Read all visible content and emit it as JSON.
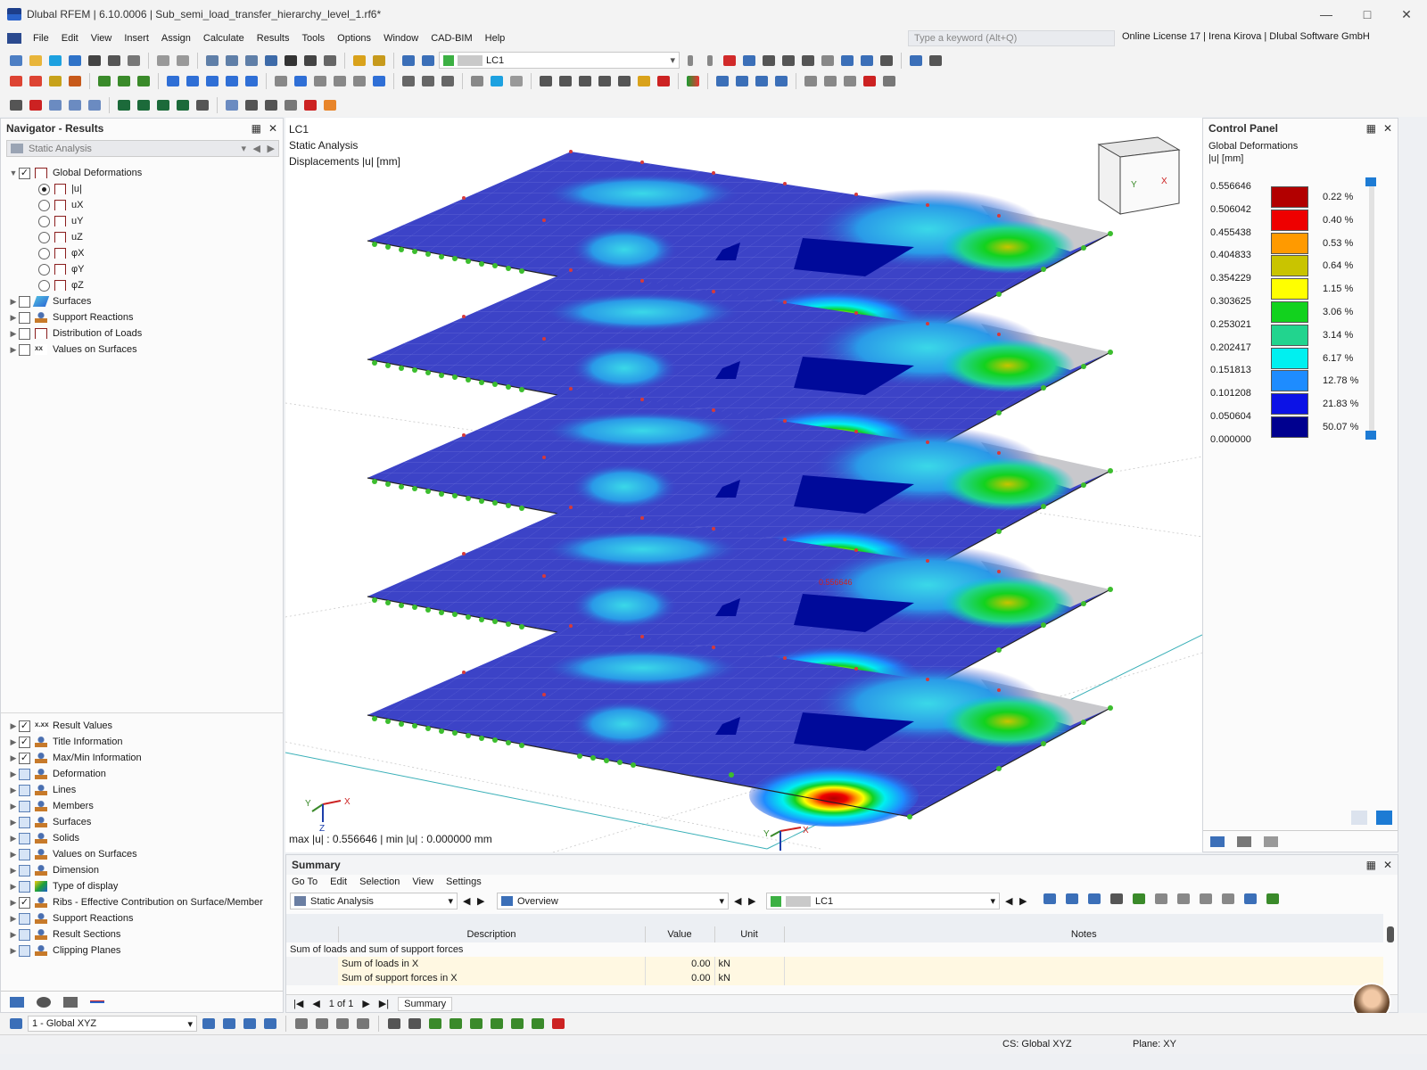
{
  "window": {
    "title": "Dlubal RFEM | 6.10.0006 | Sub_semi_load_transfer_hierarchy_level_1.rf6*"
  },
  "menu": [
    "File",
    "Edit",
    "View",
    "Insert",
    "Assign",
    "Calculate",
    "Results",
    "Tools",
    "Options",
    "Window",
    "CAD-BIM",
    "Help"
  ],
  "search": {
    "placeholder": "Type a keyword (Alt+Q)"
  },
  "license": "Online License 17 | Irena Kirova | Dlubal Software GmbH",
  "toolbar": {
    "load_case": "LC1"
  },
  "navigator": {
    "title": "Navigator - Results",
    "combo": "Static Analysis",
    "tree": [
      {
        "label": "Global Deformations",
        "checked": true
      },
      {
        "label": "|u|",
        "radio": true
      },
      {
        "label": "uX"
      },
      {
        "label": "uY"
      },
      {
        "label": "uZ"
      },
      {
        "label": "φX"
      },
      {
        "label": "φY"
      },
      {
        "label": "φZ"
      },
      {
        "label": "Surfaces"
      },
      {
        "label": "Support Reactions"
      },
      {
        "label": "Distribution of Loads"
      },
      {
        "label": "Values on Surfaces"
      }
    ],
    "display": [
      {
        "label": "Result Values",
        "checked": true
      },
      {
        "label": "Title Information",
        "checked": true
      },
      {
        "label": "Max/Min Information",
        "checked": true
      },
      {
        "label": "Deformation"
      },
      {
        "label": "Lines"
      },
      {
        "label": "Members"
      },
      {
        "label": "Surfaces"
      },
      {
        "label": "Solids"
      },
      {
        "label": "Values on Surfaces"
      },
      {
        "label": "Dimension"
      },
      {
        "label": "Type of display"
      },
      {
        "label": "Ribs - Effective Contribution on Surface/Member",
        "checked": true
      },
      {
        "label": "Support Reactions"
      },
      {
        "label": "Result Sections"
      },
      {
        "label": "Clipping Planes"
      }
    ],
    "coord_system": "1 - Global XYZ"
  },
  "viewport": {
    "line1": "LC1",
    "line2": "Static Analysis",
    "line3": "Displacements |u| [mm]",
    "maxmin": "max |u| : 0.556646 | min |u| : 0.000000 mm",
    "max_label": "0.556646",
    "axis_x": "X",
    "axis_y": "Y",
    "axis_z": "Z"
  },
  "control_panel": {
    "title": "Control Panel",
    "sub1": "Global Deformations",
    "sub2": "|u| [mm]",
    "legend": [
      {
        "value": "0.556646",
        "color": "#b20000",
        "pct": "0.22 %"
      },
      {
        "value": "0.506042",
        "color": "#ee0000",
        "pct": "0.40 %"
      },
      {
        "value": "0.455438",
        "color": "#ff9a00",
        "pct": "0.53 %"
      },
      {
        "value": "0.404833",
        "color": "#c9c400",
        "pct": "0.64 %"
      },
      {
        "value": "0.354229",
        "color": "#ffff00",
        "pct": "1.15 %"
      },
      {
        "value": "0.303625",
        "color": "#12d21e",
        "pct": "3.06 %"
      },
      {
        "value": "0.253021",
        "color": "#22d48e",
        "pct": "3.14 %"
      },
      {
        "value": "0.202417",
        "color": "#00f0f0",
        "pct": "6.17 %"
      },
      {
        "value": "0.151813",
        "color": "#1e8cff",
        "pct": "12.78 %"
      },
      {
        "value": "0.101208",
        "color": "#0c12e6",
        "pct": "21.83 %"
      },
      {
        "value": "0.050604",
        "color": "#00008f",
        "pct": "50.07 %"
      },
      {
        "value": "0.000000"
      }
    ]
  },
  "summary": {
    "title": "Summary",
    "menu": [
      "Go To",
      "Edit",
      "Selection",
      "View",
      "Settings"
    ],
    "combo1": "Static Analysis",
    "combo2": "Overview",
    "combo3": "LC1",
    "columns": [
      "Description",
      "Value",
      "Unit",
      "Notes"
    ],
    "group": "Sum of loads and sum of support forces",
    "rows": [
      {
        "desc": "Sum of loads in X",
        "value": "0.00",
        "unit": "kN"
      },
      {
        "desc": "Sum of support forces in X",
        "value": "0.00",
        "unit": "kN"
      }
    ],
    "pager": "1 of 1",
    "tab": "Summary"
  },
  "status": {
    "cs": "CS: Global XYZ",
    "plane": "Plane: XY"
  }
}
